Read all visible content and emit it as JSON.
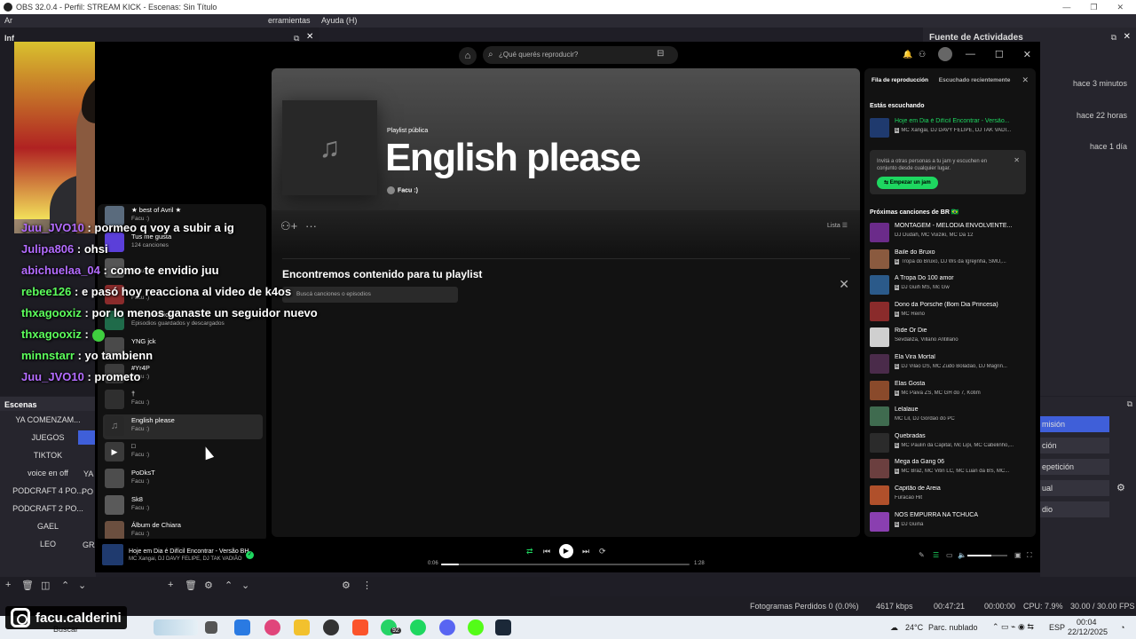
{
  "obs": {
    "title": "OBS 32.0.4 - Perfil: STREAM KICK - Escenas: Sin Título",
    "menu": [
      "Ar",
      "erramientas",
      "Ayuda (H)"
    ],
    "dock_left_label": "Inf",
    "activity_feed_title": "Fuente de Actividades",
    "activity_times": [
      "hace 3 minutos",
      "hace 22 horas",
      "hace 1 día"
    ],
    "scenes_header": "Escenas",
    "scenes": [
      "YA COMENZAM...",
      "JUEGOS",
      "TIKTOK",
      "voice en off",
      "PODCRAFT 4 PO...",
      "PODCRAFT 2 PO...",
      "GAEL",
      "LEO"
    ],
    "scenes_col2": [
      "YA",
      "PO",
      "GRA"
    ],
    "right_buttons": [
      "misión",
      "ción",
      "epetición",
      "ual",
      "dio"
    ],
    "status": {
      "dropped": "Fotogramas Perdidos 0 (0.0%)",
      "bitrate": "4617 kbps",
      "stream_time": "00:47:21",
      "rec_time": "00:00:00",
      "cpu": "CPU: 7.9%",
      "fps": "30.00 / 30.00 FPS"
    }
  },
  "chat": [
    {
      "user": "Juu_JVO10",
      "color": "purple",
      "text": ": pormeo q voy a subir a ig"
    },
    {
      "user": "Julipa806",
      "color": "purple",
      "text": ": ohsi"
    },
    {
      "user": "abichuelaa_04",
      "color": "purple",
      "text": ": como te envidio juu"
    },
    {
      "user": "rebee126",
      "color": "green",
      "text": ": e pasó hoy reacciona al video de k4os"
    },
    {
      "user": "thxagooxiz",
      "color": "green",
      "text": ": por lo menos ganaste un seguidor nuevo"
    },
    {
      "user": "thxagooxiz",
      "color": "green",
      "text": ":"
    },
    {
      "user": "minnstarr",
      "color": "green",
      "text": ": yo tambienn"
    },
    {
      "user": "Juu_JVO10",
      "color": "purple",
      "text": ": prometo"
    }
  ],
  "instagram": {
    "handle": "facu.calderini"
  },
  "taskbar": {
    "search": "Buscar",
    "weather_temp": "24°C",
    "weather_desc": "Parc. nublado",
    "lang": "ESP",
    "time": "00:04",
    "date": "22/12/2025",
    "badge": "92"
  },
  "spotify": {
    "search_placeholder": "¿Qué querés reproducir?",
    "library": [
      {
        "name": "★ best of Avril ★",
        "sub": "Facu :)"
      },
      {
        "name": "Tus me gusta",
        "sub": "124 canciones"
      },
      {
        "name": "",
        "sub": "Facu :)"
      },
      {
        "name": "",
        "sub": "Facu :)"
      },
      {
        "name": "Tus episodios",
        "sub": "Episodios guardados y descargados"
      },
      {
        "name": "YNG jck",
        "sub": ""
      },
      {
        "name": "#Yr4P",
        "sub": "Facu :)"
      },
      {
        "name": "†",
        "sub": "Facu :)"
      },
      {
        "name": "English please",
        "sub": "Facu :)"
      },
      {
        "name": "□",
        "sub": "Facu :)"
      },
      {
        "name": "PoDksT",
        "sub": "Facu :)"
      },
      {
        "name": "Sk8",
        "sub": "Facu :)"
      },
      {
        "name": "Álbum de Chiara",
        "sub": "Facu :)"
      }
    ],
    "playlist": {
      "type": "Playlist pública",
      "title": "English please",
      "owner": "Facu :)",
      "view_label": "Lista",
      "find_title": "Encontremos contenido para tu playlist",
      "find_placeholder": "Buscá canciones o episodios"
    },
    "queue": {
      "tab_queue": "Fila de reproducción",
      "tab_recent": "Escuchado recientemente",
      "listening_label": "Estás escuchando",
      "now": {
        "name": "Hoje em Dia é Difícil Encontrar - Versão...",
        "artist": "MC Xangai, DJ DAVY FELIPE, DJ TAK VADI..."
      },
      "jam_text": "Invitá a otras personas a tu jam y escuchen en conjunto desde cualquier lugar.",
      "jam_button": "Empezar un jam",
      "next_label": "Próximas canciones de BR 🇧🇷",
      "tracks": [
        {
          "name": "MONTAGEM - MELODIA ENVOLVENTE...",
          "artist": "DJ Dudah, MC Vuiziki, MC Da 12",
          "explicit": false
        },
        {
          "name": "Baile do Bruxo",
          "artist": "Tropa do Bruxo, DJ Ws da Igrejinha, SMU,...",
          "explicit": true
        },
        {
          "name": "A Tropa Do 100 amor",
          "artist": "DJ Guih MS, Mc Gw",
          "explicit": true
        },
        {
          "name": "Dono da Porsche (Bom Dia Princesa)",
          "artist": "MC Reino",
          "explicit": true
        },
        {
          "name": "Ride Or Die",
          "artist": "Sevdaliza, Villano Antillano",
          "explicit": false
        },
        {
          "name": "Ela Vira Mortal",
          "artist": "DJ Vilão DS, MC Zudo Boladão, DJ Magrin...",
          "explicit": true
        },
        {
          "name": "Elas Gosta",
          "artist": "Mc Paiva ZS, MC GH do 7, Kotim",
          "explicit": true
        },
        {
          "name": "Lelalaue",
          "artist": "MC Lil, DJ Gordão do PC",
          "explicit": false
        },
        {
          "name": "Quebradas",
          "artist": "MC Paulin da Capital, Mc Lipi, MC Cabelinho,...",
          "explicit": true
        },
        {
          "name": "Mega da Gang 06",
          "artist": "MC Braz, MC Vitin LC, MC Luan da BS, MC...",
          "explicit": true
        },
        {
          "name": "Capitão de Areia",
          "artist": "Furacão Hit",
          "explicit": false
        },
        {
          "name": "NOS EMPURRA NA TCHUCA",
          "artist": "DJ Guina",
          "explicit": true
        }
      ]
    },
    "player": {
      "title": "Hoje em Dia é Difícil Encontrar - Versão BH",
      "artist": "MC Xangai, DJ DAVY FELIPE, DJ TAK VADIÃO",
      "current": "0:06",
      "total": "1:28",
      "progress": 0.07,
      "volume": 0.6
    }
  },
  "colors": {
    "accent": "#1ed760",
    "obs_bg": "#1d1c23",
    "spotify_bg": "#121212"
  }
}
